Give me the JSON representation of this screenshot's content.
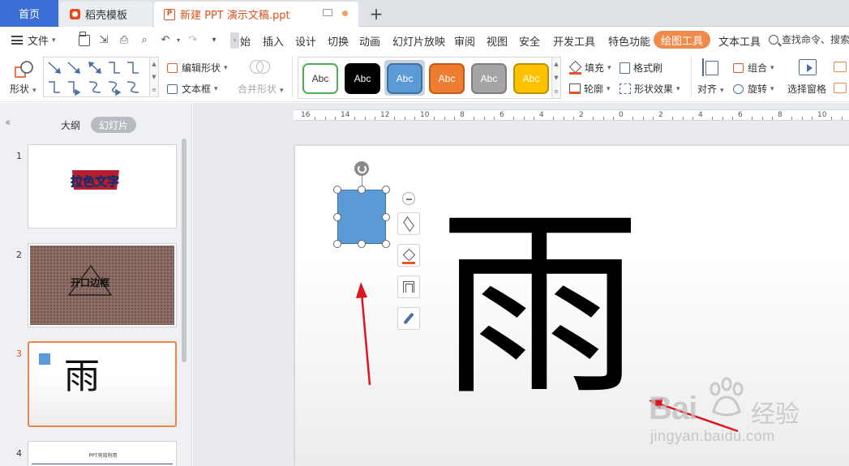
{
  "tabs": {
    "home": "首页",
    "template": "稻壳模板",
    "document": "新建 PPT 演示文稿.ppt",
    "add": "+"
  },
  "menu": {
    "file": "文件",
    "items": [
      "插入",
      "设计",
      "切换",
      "动画",
      "幻灯片放映",
      "审阅",
      "视图",
      "安全",
      "开发工具",
      "特色功能"
    ],
    "partial_start": "始",
    "active": "绘图工具",
    "after_active": "文本工具",
    "search": "查找命令、搜索"
  },
  "ribbon": {
    "shape": "形状",
    "edit_shape": "编辑形状",
    "text_box": "文本框",
    "merge_shape": "合并形状",
    "styles": [
      {
        "label": "Abc",
        "bg": "#ffffff",
        "fg": "#333333",
        "border": "#4caf50"
      },
      {
        "label": "Abc",
        "bg": "#000000",
        "fg": "#ffffff",
        "border": "#000000"
      },
      {
        "label": "Abc",
        "bg": "#5b9bd5",
        "fg": "#ffffff",
        "border": "#41719c"
      },
      {
        "label": "Abc",
        "bg": "#ed7d31",
        "fg": "#ffffff",
        "border": "#c55a11"
      },
      {
        "label": "Abc",
        "bg": "#a5a5a5",
        "fg": "#ffffff",
        "border": "#7f7f7f"
      },
      {
        "label": "Abc",
        "bg": "#ffc000",
        "fg": "#ffffff",
        "border": "#bf9000"
      }
    ],
    "fill": "填充",
    "format_painter": "格式刷",
    "outline": "轮廓",
    "shape_effect": "形状效果",
    "align": "对齐",
    "group": "组合",
    "rotate": "旋转",
    "selection_pane": "选择窗格"
  },
  "panel": {
    "outline_tab": "大纲",
    "slides_tab": "幻灯片",
    "slides": [
      {
        "num": "1",
        "text": "拉色文字"
      },
      {
        "num": "2",
        "text": "开口边框"
      },
      {
        "num": "3",
        "text": "雨"
      },
      {
        "num": "4",
        "text": "PPT壳效利用"
      }
    ]
  },
  "ruler": {
    "labels": [
      "16",
      "14",
      "12",
      "10",
      "8",
      "6",
      "4",
      "2",
      "0",
      "2",
      "4",
      "6",
      "8",
      "10"
    ]
  },
  "slide": {
    "main_char": "雨",
    "shape_color": "#5b9bd5"
  },
  "watermark": {
    "brand": "Bai",
    "brand_tail": "经验",
    "url": "jingyan.baidu.com"
  },
  "colors": {
    "accent": "#f08a4b",
    "home_tab": "#3c6fd6",
    "arrow": "#e0141e"
  }
}
